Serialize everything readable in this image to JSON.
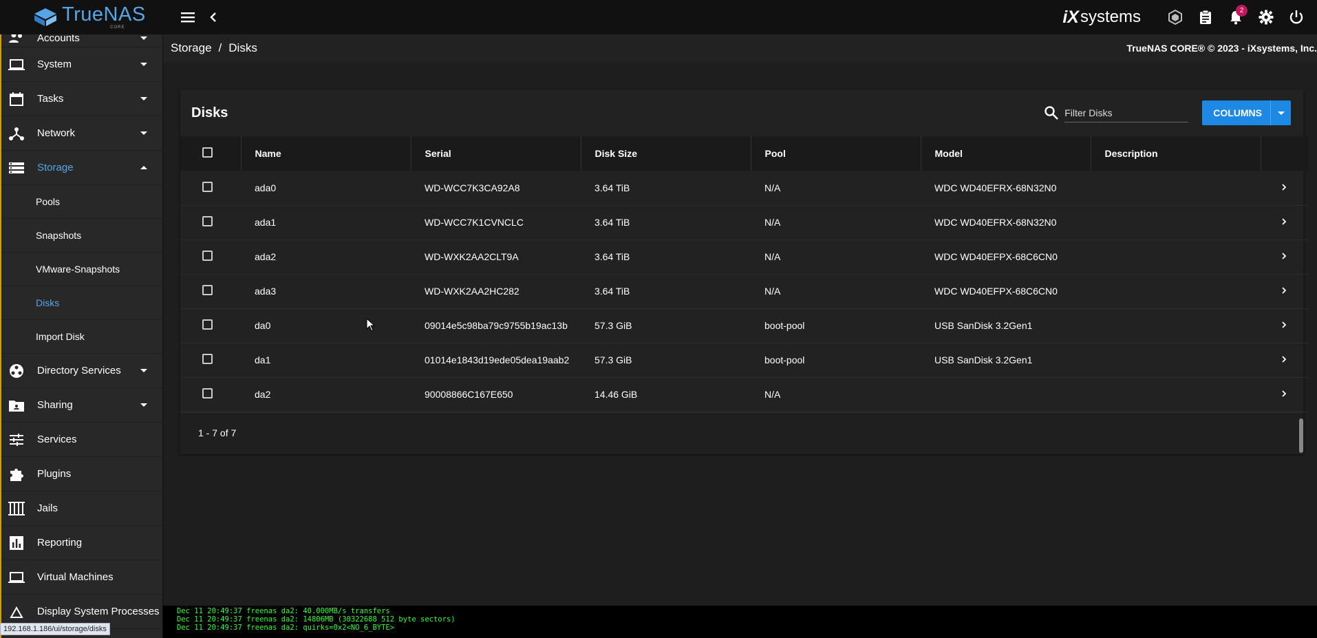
{
  "topbar": {
    "brand_name": "TrueNAS",
    "brand_edition": "CORE",
    "vendor_logo_ix": "iX",
    "vendor_logo_systems": "systems",
    "notification_count": "2",
    "icons": [
      "menu-icon",
      "chevron-left-icon",
      "truecommand-icon",
      "clipboard-icon",
      "bell-icon",
      "gear-icon",
      "power-icon"
    ]
  },
  "breadcrumb": {
    "parent": "Storage",
    "current": "Disks",
    "separator": "/",
    "copyright": "TrueNAS CORE® © 2023 - iXsystems, Inc."
  },
  "sidebar": {
    "items": [
      {
        "label": "Accounts",
        "icon": "people-icon"
      },
      {
        "label": "System",
        "icon": "laptop-icon"
      },
      {
        "label": "Tasks",
        "icon": "calendar-icon"
      },
      {
        "label": "Network",
        "icon": "network-icon"
      },
      {
        "label": "Storage",
        "icon": "storage-icon"
      },
      {
        "label": "Directory Services",
        "icon": "directory-icon"
      },
      {
        "label": "Sharing",
        "icon": "folder-share-icon"
      },
      {
        "label": "Services",
        "icon": "tune-icon"
      },
      {
        "label": "Plugins",
        "icon": "puzzle-icon"
      },
      {
        "label": "Jails",
        "icon": "jail-icon"
      },
      {
        "label": "Reporting",
        "icon": "chart-icon"
      },
      {
        "label": "Virtual Machines",
        "icon": "computer-icon"
      },
      {
        "label": "Display System Processes",
        "icon": "process-icon"
      }
    ],
    "storage_sub": [
      "Pools",
      "Snapshots",
      "VMware-Snapshots",
      "Disks",
      "Import Disk"
    ]
  },
  "card": {
    "title": "Disks",
    "filter_placeholder": "Filter Disks",
    "columns_button": "COLUMNS",
    "headers": [
      "Name",
      "Serial",
      "Disk Size",
      "Pool",
      "Model",
      "Description"
    ],
    "rows": [
      {
        "name": "ada0",
        "serial": "WD-WCC7K3CA92A8",
        "size": "3.64 TiB",
        "pool": "N/A",
        "model": "WDC WD40EFRX-68N32N0",
        "description": ""
      },
      {
        "name": "ada1",
        "serial": "WD-WCC7K1CVNCLC",
        "size": "3.64 TiB",
        "pool": "N/A",
        "model": "WDC WD40EFRX-68N32N0",
        "description": ""
      },
      {
        "name": "ada2",
        "serial": "WD-WXK2AA2CLT9A",
        "size": "3.64 TiB",
        "pool": "N/A",
        "model": "WDC WD40EFPX-68C6CN0",
        "description": ""
      },
      {
        "name": "ada3",
        "serial": "WD-WXK2AA2HC282",
        "size": "3.64 TiB",
        "pool": "N/A",
        "model": "WDC WD40EFPX-68C6CN0",
        "description": ""
      },
      {
        "name": "da0",
        "serial": "09014e5c98ba79c9755b19ac13b",
        "size": "57.3 GiB",
        "pool": "boot-pool",
        "model": "USB SanDisk 3.2Gen1",
        "description": ""
      },
      {
        "name": "da1",
        "serial": "01014e1843d19ede05dea19aab2",
        "size": "57.3 GiB",
        "pool": "boot-pool",
        "model": "USB SanDisk 3.2Gen1",
        "description": ""
      },
      {
        "name": "da2",
        "serial": "90008866C167E650",
        "size": "14.46 GiB",
        "pool": "N/A",
        "model": "",
        "description": ""
      }
    ],
    "pagination": "1 - 7 of 7"
  },
  "console": [
    "Dec 11 20:49:37 freenas da2: 40.000MB/s transfers",
    "Dec 11 20:49:37 freenas da2: 14806MB (30322688 512 byte sectors)",
    "Dec 11 20:49:37 freenas da2: quirks=0x2<NO_6_BYTE>"
  ],
  "status_url": "192.168.1.186/ui/storage/disks",
  "colors": {
    "accent": "#56a6e6",
    "button": "#1e88e5",
    "badge": "#c2185b",
    "console_text": "#33ff33"
  }
}
